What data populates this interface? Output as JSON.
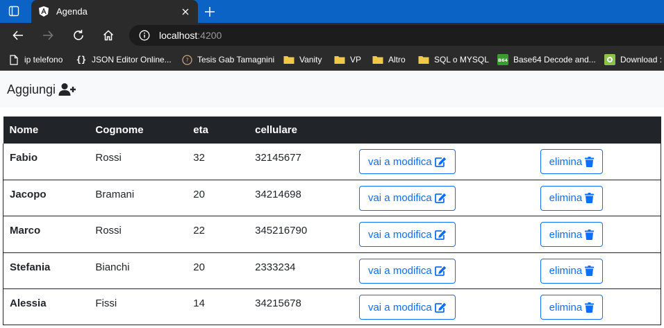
{
  "browser": {
    "tab_title": "Agenda",
    "url_host": "localhost",
    "url_port": ":4200"
  },
  "bookmarks": [
    {
      "label": "ip telefono",
      "icon": "page-icon"
    },
    {
      "label": "JSON Editor Online...",
      "icon": "braces-icon"
    },
    {
      "label": "Tesis Gab Tamagnini",
      "icon": "circle-icon"
    },
    {
      "label": "Vanity",
      "icon": "folder-icon"
    },
    {
      "label": "VP",
      "icon": "folder-icon"
    },
    {
      "label": "Altro",
      "icon": "folder-icon"
    },
    {
      "label": "SQL o MYSQL",
      "icon": "folder-icon"
    },
    {
      "label": "Base64 Decode and...",
      "icon": "b64-icon"
    },
    {
      "label": "Download :",
      "icon": "download-icon"
    }
  ],
  "page": {
    "add_label": "Aggiungi"
  },
  "table": {
    "headers": [
      "Nome",
      "Cognome",
      "eta",
      "cellulare"
    ],
    "edit_label": "vai a modifica",
    "delete_label": "elimina",
    "rows": [
      {
        "nome": "Fabio",
        "cognome": "Rossi",
        "eta": "32",
        "cellulare": "32145677"
      },
      {
        "nome": "Jacopo",
        "cognome": "Bramani",
        "eta": "20",
        "cellulare": "34214698"
      },
      {
        "nome": "Marco",
        "cognome": "Rossi",
        "eta": "22",
        "cellulare": "345216790"
      },
      {
        "nome": "Stefania",
        "cognome": "Bianchi",
        "eta": "20",
        "cellulare": "2333234"
      },
      {
        "nome": "Alessia",
        "cognome": "Fissi",
        "eta": "14",
        "cellulare": "34215678"
      }
    ]
  },
  "colors": {
    "primary": "#0d6efd",
    "dark": "#212529",
    "light": "#f8f9fa"
  }
}
